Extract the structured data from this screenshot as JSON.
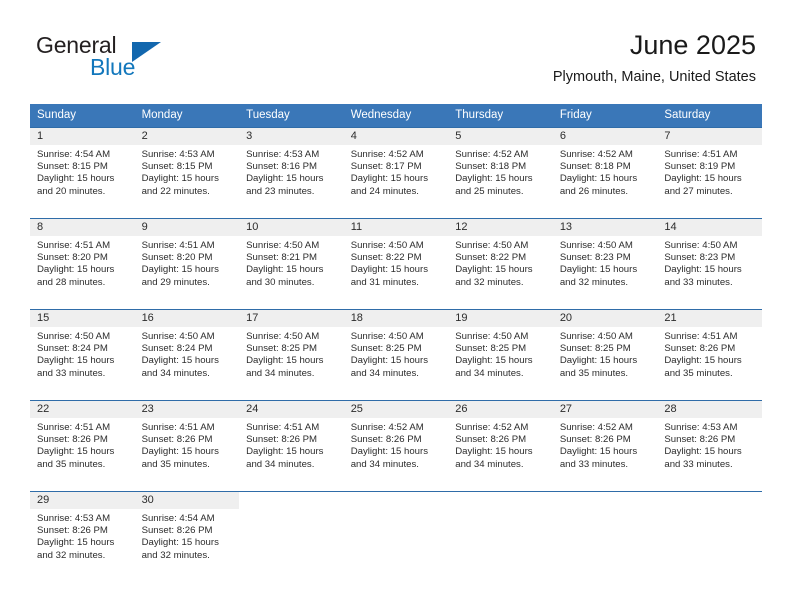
{
  "brand": {
    "name_part1": "General",
    "name_part2": "Blue",
    "accent_color": "#1267ae",
    "blue_text_color": "#1277bc"
  },
  "header": {
    "title": "June 2025",
    "location": "Plymouth, Maine, United States"
  },
  "calendar": {
    "header_bg": "#3a77b8",
    "daynum_bg": "#efefef",
    "weekday_headers": [
      "Sunday",
      "Monday",
      "Tuesday",
      "Wednesday",
      "Thursday",
      "Friday",
      "Saturday"
    ],
    "weeks": [
      [
        {
          "day": "1",
          "sunrise": "Sunrise: 4:54 AM",
          "sunset": "Sunset: 8:15 PM",
          "daylight_line1": "Daylight: 15 hours",
          "daylight_line2": "and 20 minutes."
        },
        {
          "day": "2",
          "sunrise": "Sunrise: 4:53 AM",
          "sunset": "Sunset: 8:15 PM",
          "daylight_line1": "Daylight: 15 hours",
          "daylight_line2": "and 22 minutes."
        },
        {
          "day": "3",
          "sunrise": "Sunrise: 4:53 AM",
          "sunset": "Sunset: 8:16 PM",
          "daylight_line1": "Daylight: 15 hours",
          "daylight_line2": "and 23 minutes."
        },
        {
          "day": "4",
          "sunrise": "Sunrise: 4:52 AM",
          "sunset": "Sunset: 8:17 PM",
          "daylight_line1": "Daylight: 15 hours",
          "daylight_line2": "and 24 minutes."
        },
        {
          "day": "5",
          "sunrise": "Sunrise: 4:52 AM",
          "sunset": "Sunset: 8:18 PM",
          "daylight_line1": "Daylight: 15 hours",
          "daylight_line2": "and 25 minutes."
        },
        {
          "day": "6",
          "sunrise": "Sunrise: 4:52 AM",
          "sunset": "Sunset: 8:18 PM",
          "daylight_line1": "Daylight: 15 hours",
          "daylight_line2": "and 26 minutes."
        },
        {
          "day": "7",
          "sunrise": "Sunrise: 4:51 AM",
          "sunset": "Sunset: 8:19 PM",
          "daylight_line1": "Daylight: 15 hours",
          "daylight_line2": "and 27 minutes."
        }
      ],
      [
        {
          "day": "8",
          "sunrise": "Sunrise: 4:51 AM",
          "sunset": "Sunset: 8:20 PM",
          "daylight_line1": "Daylight: 15 hours",
          "daylight_line2": "and 28 minutes."
        },
        {
          "day": "9",
          "sunrise": "Sunrise: 4:51 AM",
          "sunset": "Sunset: 8:20 PM",
          "daylight_line1": "Daylight: 15 hours",
          "daylight_line2": "and 29 minutes."
        },
        {
          "day": "10",
          "sunrise": "Sunrise: 4:50 AM",
          "sunset": "Sunset: 8:21 PM",
          "daylight_line1": "Daylight: 15 hours",
          "daylight_line2": "and 30 minutes."
        },
        {
          "day": "11",
          "sunrise": "Sunrise: 4:50 AM",
          "sunset": "Sunset: 8:22 PM",
          "daylight_line1": "Daylight: 15 hours",
          "daylight_line2": "and 31 minutes."
        },
        {
          "day": "12",
          "sunrise": "Sunrise: 4:50 AM",
          "sunset": "Sunset: 8:22 PM",
          "daylight_line1": "Daylight: 15 hours",
          "daylight_line2": "and 32 minutes."
        },
        {
          "day": "13",
          "sunrise": "Sunrise: 4:50 AM",
          "sunset": "Sunset: 8:23 PM",
          "daylight_line1": "Daylight: 15 hours",
          "daylight_line2": "and 32 minutes."
        },
        {
          "day": "14",
          "sunrise": "Sunrise: 4:50 AM",
          "sunset": "Sunset: 8:23 PM",
          "daylight_line1": "Daylight: 15 hours",
          "daylight_line2": "and 33 minutes."
        }
      ],
      [
        {
          "day": "15",
          "sunrise": "Sunrise: 4:50 AM",
          "sunset": "Sunset: 8:24 PM",
          "daylight_line1": "Daylight: 15 hours",
          "daylight_line2": "and 33 minutes."
        },
        {
          "day": "16",
          "sunrise": "Sunrise: 4:50 AM",
          "sunset": "Sunset: 8:24 PM",
          "daylight_line1": "Daylight: 15 hours",
          "daylight_line2": "and 34 minutes."
        },
        {
          "day": "17",
          "sunrise": "Sunrise: 4:50 AM",
          "sunset": "Sunset: 8:25 PM",
          "daylight_line1": "Daylight: 15 hours",
          "daylight_line2": "and 34 minutes."
        },
        {
          "day": "18",
          "sunrise": "Sunrise: 4:50 AM",
          "sunset": "Sunset: 8:25 PM",
          "daylight_line1": "Daylight: 15 hours",
          "daylight_line2": "and 34 minutes."
        },
        {
          "day": "19",
          "sunrise": "Sunrise: 4:50 AM",
          "sunset": "Sunset: 8:25 PM",
          "daylight_line1": "Daylight: 15 hours",
          "daylight_line2": "and 34 minutes."
        },
        {
          "day": "20",
          "sunrise": "Sunrise: 4:50 AM",
          "sunset": "Sunset: 8:25 PM",
          "daylight_line1": "Daylight: 15 hours",
          "daylight_line2": "and 35 minutes."
        },
        {
          "day": "21",
          "sunrise": "Sunrise: 4:51 AM",
          "sunset": "Sunset: 8:26 PM",
          "daylight_line1": "Daylight: 15 hours",
          "daylight_line2": "and 35 minutes."
        }
      ],
      [
        {
          "day": "22",
          "sunrise": "Sunrise: 4:51 AM",
          "sunset": "Sunset: 8:26 PM",
          "daylight_line1": "Daylight: 15 hours",
          "daylight_line2": "and 35 minutes."
        },
        {
          "day": "23",
          "sunrise": "Sunrise: 4:51 AM",
          "sunset": "Sunset: 8:26 PM",
          "daylight_line1": "Daylight: 15 hours",
          "daylight_line2": "and 35 minutes."
        },
        {
          "day": "24",
          "sunrise": "Sunrise: 4:51 AM",
          "sunset": "Sunset: 8:26 PM",
          "daylight_line1": "Daylight: 15 hours",
          "daylight_line2": "and 34 minutes."
        },
        {
          "day": "25",
          "sunrise": "Sunrise: 4:52 AM",
          "sunset": "Sunset: 8:26 PM",
          "daylight_line1": "Daylight: 15 hours",
          "daylight_line2": "and 34 minutes."
        },
        {
          "day": "26",
          "sunrise": "Sunrise: 4:52 AM",
          "sunset": "Sunset: 8:26 PM",
          "daylight_line1": "Daylight: 15 hours",
          "daylight_line2": "and 34 minutes."
        },
        {
          "day": "27",
          "sunrise": "Sunrise: 4:52 AM",
          "sunset": "Sunset: 8:26 PM",
          "daylight_line1": "Daylight: 15 hours",
          "daylight_line2": "and 33 minutes."
        },
        {
          "day": "28",
          "sunrise": "Sunrise: 4:53 AM",
          "sunset": "Sunset: 8:26 PM",
          "daylight_line1": "Daylight: 15 hours",
          "daylight_line2": "and 33 minutes."
        }
      ],
      [
        {
          "day": "29",
          "sunrise": "Sunrise: 4:53 AM",
          "sunset": "Sunset: 8:26 PM",
          "daylight_line1": "Daylight: 15 hours",
          "daylight_line2": "and 32 minutes."
        },
        {
          "day": "30",
          "sunrise": "Sunrise: 4:54 AM",
          "sunset": "Sunset: 8:26 PM",
          "daylight_line1": "Daylight: 15 hours",
          "daylight_line2": "and 32 minutes."
        },
        {
          "day": "",
          "sunrise": "",
          "sunset": "",
          "daylight_line1": "",
          "daylight_line2": ""
        },
        {
          "day": "",
          "sunrise": "",
          "sunset": "",
          "daylight_line1": "",
          "daylight_line2": ""
        },
        {
          "day": "",
          "sunrise": "",
          "sunset": "",
          "daylight_line1": "",
          "daylight_line2": ""
        },
        {
          "day": "",
          "sunrise": "",
          "sunset": "",
          "daylight_line1": "",
          "daylight_line2": ""
        },
        {
          "day": "",
          "sunrise": "",
          "sunset": "",
          "daylight_line1": "",
          "daylight_line2": ""
        }
      ]
    ]
  }
}
